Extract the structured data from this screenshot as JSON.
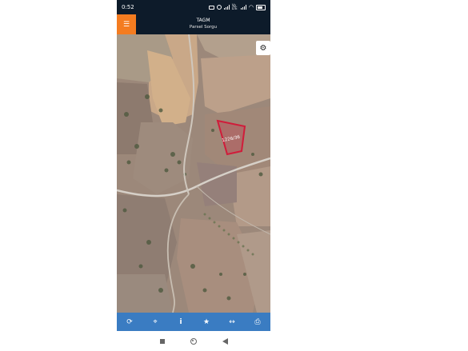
{
  "status_bar": {
    "time": "0:52",
    "network_label": "Vo LTE",
    "icons": [
      "sim-icon",
      "location-icon",
      "signal-icon",
      "signal-icon",
      "wifi-icon",
      "battery-icon"
    ]
  },
  "app_bar": {
    "title": "TAGM",
    "subtitle": "Parsel Sorgu",
    "menu_icon": "hamburger-icon",
    "accent_color": "#f47c20",
    "bar_color": "#0d1b2a"
  },
  "map": {
    "parcel_label": "1226/36",
    "parcel_color": "#d01c3a",
    "settings_icon": "gear-icon"
  },
  "toolbar": {
    "color": "#3a7cc2",
    "buttons": [
      {
        "name": "refresh-button",
        "icon": "refresh-icon",
        "glyph": "⟳"
      },
      {
        "name": "locate-button",
        "icon": "crosshair-icon",
        "glyph": "⌖"
      },
      {
        "name": "info-button",
        "icon": "info-icon",
        "glyph": "i"
      },
      {
        "name": "favorite-button",
        "icon": "star-icon",
        "glyph": "★"
      },
      {
        "name": "measure-button",
        "icon": "measure-icon",
        "glyph": "↔"
      },
      {
        "name": "print-button",
        "icon": "printer-icon",
        "glyph": "⎙"
      }
    ]
  }
}
